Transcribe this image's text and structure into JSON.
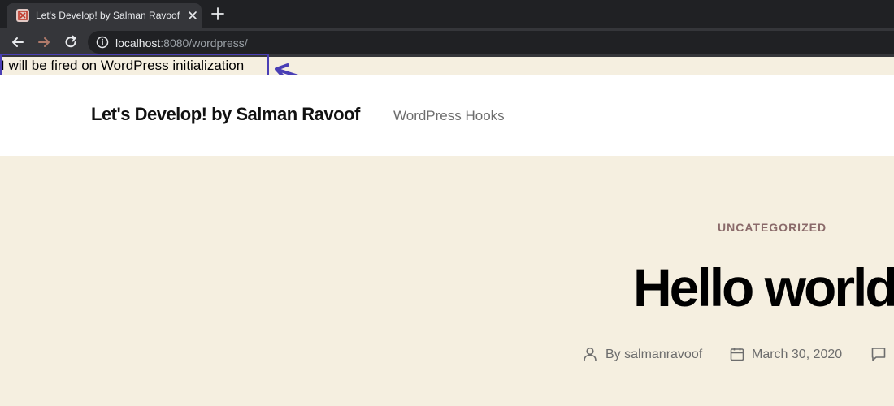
{
  "browser": {
    "tab": {
      "title": "Let's Develop! by Salman Ravoof"
    },
    "address_bar": {
      "host": "localhost",
      "rest": ":8080/wordpress/"
    }
  },
  "hook_notice": {
    "text": "I will be fired on WordPress initialization"
  },
  "site": {
    "title": "Let's Develop! by Salman Ravoof",
    "description": "WordPress Hooks"
  },
  "post": {
    "category": "UNCATEGORIZED",
    "title": "Hello world",
    "author": "By salmanravoof",
    "date": "March 30, 2020"
  },
  "colors": {
    "page_background": "#f5efe0",
    "header_background": "#ffffff",
    "annotation_purple": "#4a3fb5"
  }
}
